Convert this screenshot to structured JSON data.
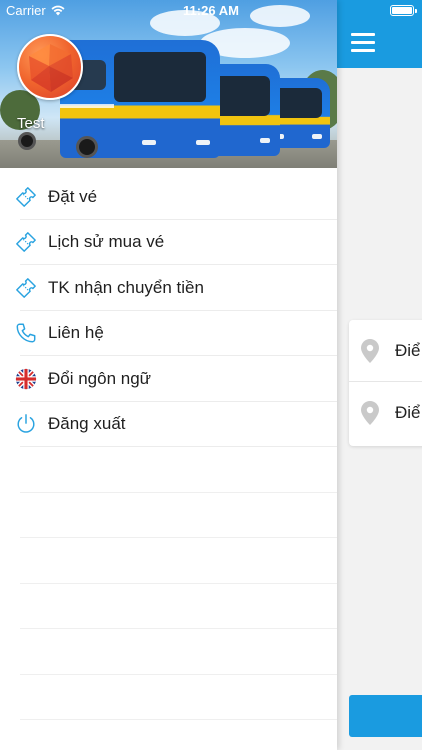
{
  "status_bar": {
    "carrier": "Carrier",
    "time": "11:26 AM"
  },
  "profile": {
    "username": "Test"
  },
  "menu": {
    "items": [
      {
        "label": "Đặt vé",
        "icon": "ticket-icon"
      },
      {
        "label": "Lịch sử mua vé",
        "icon": "ticket-icon"
      },
      {
        "label": "TK nhận chuyển tiền",
        "icon": "ticket-icon"
      },
      {
        "label": "Liên hệ",
        "icon": "phone-icon"
      },
      {
        "label": "Đổi ngôn ngữ",
        "icon": "uk-flag-icon"
      },
      {
        "label": "Đăng xuất",
        "icon": "power-icon"
      }
    ]
  },
  "main": {
    "origin_partial": "Điể",
    "destination_partial": "Điể"
  },
  "colors": {
    "accent": "#1a9be0",
    "icon": "#2aa3e0"
  }
}
